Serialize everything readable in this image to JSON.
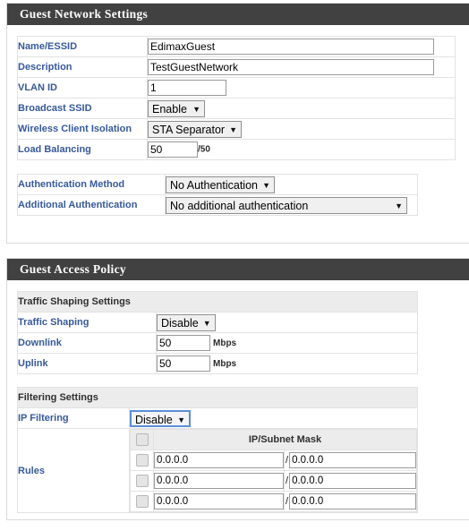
{
  "theme": {
    "header_bg": "#414141",
    "header_text": "#ffffff",
    "label_blue": "#36599b",
    "subheader_bg": "#ececec",
    "panel_border": "#d9d9d9",
    "focus_blue": "#5a8fd6"
  },
  "guest_network": {
    "title": "Guest Network Settings",
    "fields": [
      {
        "label": "Name/ESSID",
        "type": "text",
        "value": "EdimaxGuest"
      },
      {
        "label": "Description",
        "type": "text",
        "value": "TestGuestNetwork"
      },
      {
        "label": "VLAN ID",
        "type": "text",
        "value": "1"
      },
      {
        "label": "Broadcast SSID",
        "type": "select",
        "value": "Enable"
      },
      {
        "label": "Wireless Client Isolation",
        "type": "select",
        "value": "STA Separator"
      },
      {
        "label": "Load Balancing",
        "type": "text",
        "value": "50",
        "suffix": "/50"
      }
    ],
    "auth": [
      {
        "label": "Authentication Method",
        "type": "select",
        "value": "No Authentication"
      },
      {
        "label": "Additional Authentication",
        "type": "select",
        "value": "No additional authentication"
      }
    ]
  },
  "guest_access_policy": {
    "title": "Guest Access Policy",
    "traffic_shaping": {
      "subheader": "Traffic Shaping Settings",
      "rows": [
        {
          "label": "Traffic Shaping",
          "type": "select",
          "value": "Disable"
        },
        {
          "label": "Downlink",
          "type": "text",
          "value": "50",
          "unit": "Mbps"
        },
        {
          "label": "Uplink",
          "type": "text",
          "value": "50",
          "unit": "Mbps"
        }
      ]
    },
    "filtering": {
      "subheader": "Filtering Settings",
      "ip_filtering": {
        "label": "IP Filtering",
        "value": "Disable"
      },
      "rules_label": "Rules",
      "rules_header": "IP/Subnet Mask",
      "rules": [
        {
          "checked": false,
          "ip": "0.0.0.0",
          "mask": "0.0.0.0"
        },
        {
          "checked": false,
          "ip": "0.0.0.0",
          "mask": "0.0.0.0"
        },
        {
          "checked": false,
          "ip": "0.0.0.0",
          "mask": "0.0.0.0"
        }
      ]
    }
  },
  "icons": {
    "dropdown_arrow": "▼",
    "mask_slash": "/"
  }
}
